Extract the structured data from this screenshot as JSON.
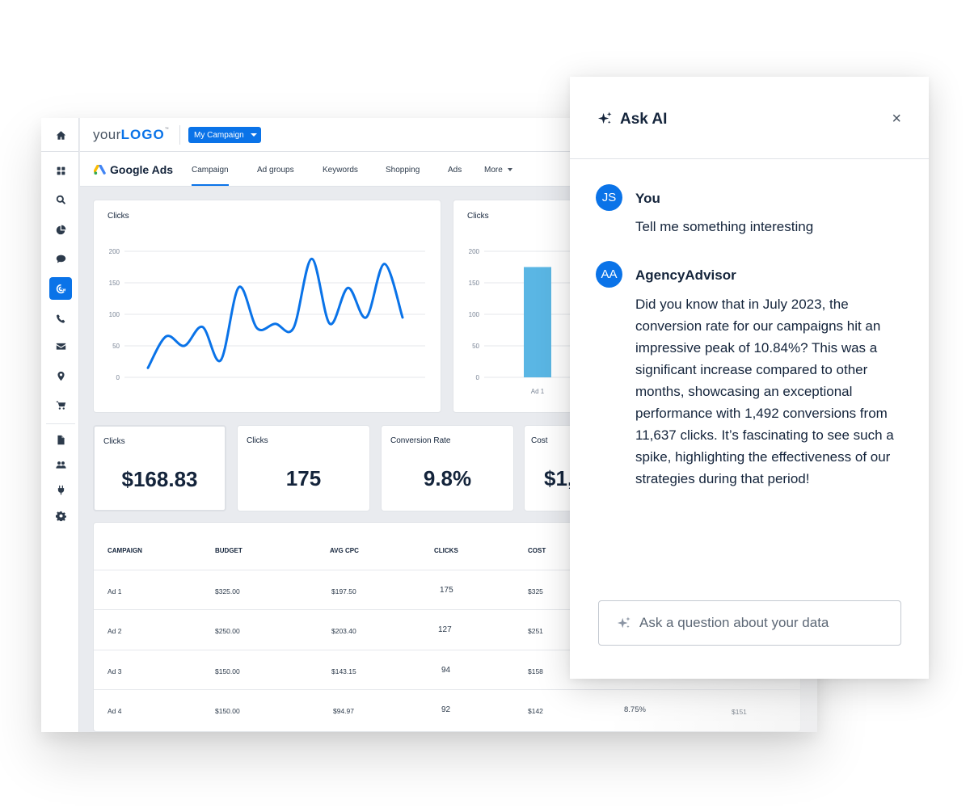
{
  "colors": {
    "accent": "#0a73e8",
    "line": "#0a73e8",
    "bar": "#5ab6e4",
    "text": "#14243b"
  },
  "topbar": {
    "logo_prefix": "your",
    "logo_brand": "LOGO",
    "logo_tm": "™",
    "campaign_selector": "My Campaign"
  },
  "sidebar": {
    "items": [
      {
        "icon": "home-icon"
      },
      {
        "icon": "dashboard-grid-icon"
      },
      {
        "icon": "search-icon"
      },
      {
        "icon": "pie-chart-icon"
      },
      {
        "icon": "chat-icon"
      },
      {
        "icon": "ppc-target-icon",
        "active": true
      },
      {
        "icon": "phone-icon"
      },
      {
        "icon": "email-icon"
      },
      {
        "icon": "location-pin-icon"
      },
      {
        "icon": "cart-icon"
      },
      {
        "icon": "document-icon"
      },
      {
        "icon": "users-icon"
      },
      {
        "icon": "plug-icon"
      },
      {
        "icon": "settings-gear-icon"
      }
    ]
  },
  "nav": {
    "platform": "Google Ads",
    "tabs": [
      "Campaign",
      "Ad groups",
      "Keywords",
      "Shopping",
      "Ads",
      "More"
    ],
    "active_tab": "Campaign"
  },
  "chart_data": [
    {
      "type": "line",
      "title": "Clicks",
      "xlabel": "",
      "ylabel": "",
      "ylim": [
        0,
        200
      ],
      "yticks": [
        "0",
        "50",
        "100",
        "150",
        "200"
      ],
      "grid": true,
      "smooth": true,
      "values": [
        15,
        65,
        50,
        80,
        27,
        143,
        78,
        85,
        78,
        188,
        85,
        142,
        95,
        180,
        95
      ]
    },
    {
      "type": "bar",
      "title": "Clicks",
      "ylim": [
        0,
        200
      ],
      "yticks": [
        "0",
        "50",
        "100",
        "150",
        "200"
      ],
      "grid": true,
      "categories": [
        "Ad 1"
      ],
      "values": [
        175
      ]
    }
  ],
  "kpis": [
    {
      "title": "Clicks",
      "value": "$168.83"
    },
    {
      "title": "Clicks",
      "value": "175"
    },
    {
      "title": "Conversion Rate",
      "value": "9.8%"
    },
    {
      "title": "Cost",
      "value": "$1,"
    }
  ],
  "table": {
    "headers": [
      "CAMPAIGN",
      "BUDGET",
      "AVG CPC",
      "CLICKS",
      "COST"
    ],
    "rows": [
      {
        "campaign": "Ad 1",
        "budget": "$325.00",
        "avg_cpc": "$197.50",
        "clicks": "175",
        "cost": "$325",
        "extra1": "",
        "extra2": ""
      },
      {
        "campaign": "Ad 2",
        "budget": "$250.00",
        "avg_cpc": "$203.40",
        "clicks": "127",
        "cost": "$251",
        "extra1": "",
        "extra2": ""
      },
      {
        "campaign": "Ad 3",
        "budget": "$150.00",
        "avg_cpc": "$143.15",
        "clicks": "94",
        "cost": "$158",
        "extra1": "",
        "extra2": ""
      },
      {
        "campaign": "Ad 4",
        "budget": "$150.00",
        "avg_cpc": "$94.97",
        "clicks": "92",
        "cost": "$142",
        "extra1": "8.75%",
        "extra2": "$151"
      }
    ]
  },
  "ai_panel": {
    "title": "Ask AI",
    "close": "×",
    "messages": [
      {
        "initials": "JS",
        "name": "You",
        "text": "Tell me something interesting"
      },
      {
        "initials": "AA",
        "name": "AgencyAdvisor",
        "text": "Did you know that in July 2023, the conversion rate for our campaigns hit an impressive peak of 10.84%? This was a significant increase compared to other months, showcasing an exceptional performance with 1,492 conversions from 11,637 clicks. It’s fascinating to see such a spike, highlighting the effectiveness of our strategies during that period!"
      }
    ],
    "input_placeholder": "Ask a question about your data",
    "input_value": ""
  }
}
